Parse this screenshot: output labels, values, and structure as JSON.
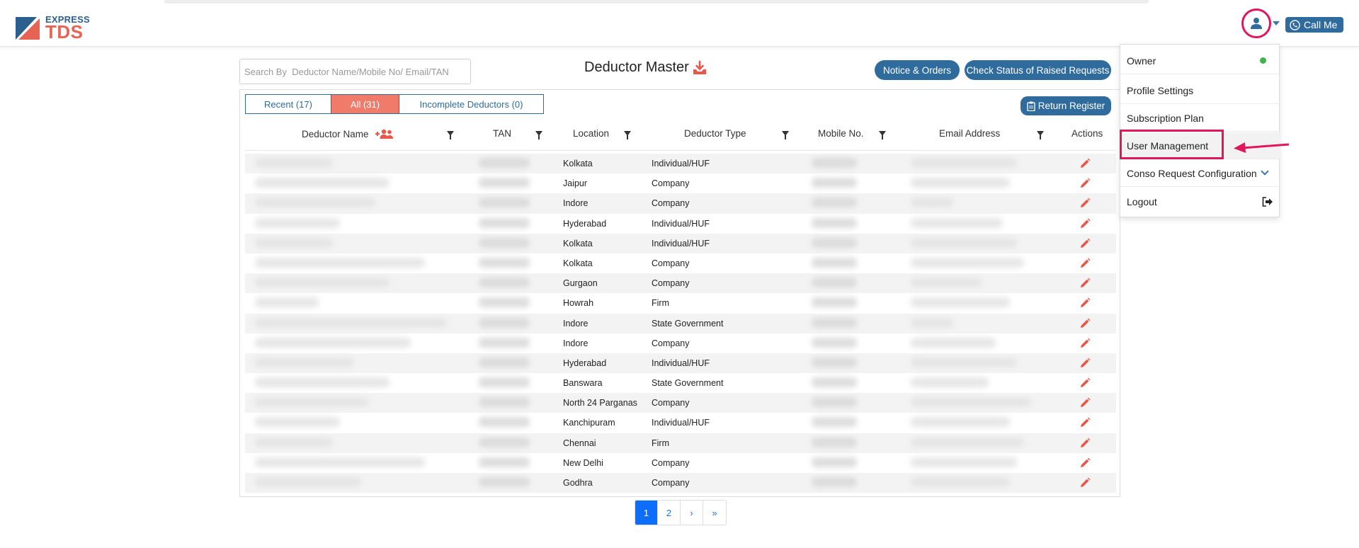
{
  "logo": {
    "top_text": "EXPRESS",
    "main_text": "TDS"
  },
  "header": {
    "call_me_label": "Call Me"
  },
  "search": {
    "placeholder": "Search By  Deductor Name/Mobile No/ Email/TAN"
  },
  "page": {
    "title": "Deductor Master"
  },
  "buttons": {
    "notice_orders": "Notice & Orders",
    "check_status": "Check Status of Raised Requests",
    "return_register": "Return Register"
  },
  "tabs": [
    {
      "label": "Recent (17)"
    },
    {
      "label": "All (31)",
      "active": true
    },
    {
      "label": "Incomplete Deductors (0)"
    }
  ],
  "columns": {
    "deductor_name": "Deductor Name",
    "tan": "TAN",
    "location": "Location",
    "deductor_type": "Deductor Type",
    "mobile": "Mobile No.",
    "email": "Email Address",
    "actions": "Actions"
  },
  "rows": [
    {
      "location": "Kolkata",
      "type": "Individual/HUF"
    },
    {
      "location": "Jaipur",
      "type": "Company"
    },
    {
      "location": "Indore",
      "type": "Company"
    },
    {
      "location": "Hyderabad",
      "type": "Individual/HUF"
    },
    {
      "location": "Kolkata",
      "type": "Individual/HUF"
    },
    {
      "location": "Kolkata",
      "type": "Company"
    },
    {
      "location": "Gurgaon",
      "type": "Company"
    },
    {
      "location": "Howrah",
      "type": "Firm"
    },
    {
      "location": "Indore",
      "type": "State Government"
    },
    {
      "location": "Indore",
      "type": "Company"
    },
    {
      "location": "Hyderabad",
      "type": "Individual/HUF"
    },
    {
      "location": "Banswara",
      "type": "State Government"
    },
    {
      "location": "North 24 Parganas",
      "type": "Company"
    },
    {
      "location": "Kanchipuram",
      "type": "Individual/HUF"
    },
    {
      "location": "Chennai",
      "type": "Firm"
    },
    {
      "location": "New Delhi",
      "type": "Company"
    },
    {
      "location": "Godhra",
      "type": "Company"
    }
  ],
  "pagination": {
    "pages": [
      "1",
      "2"
    ],
    "next": "›",
    "last": "»",
    "current": "1"
  },
  "dropdown": {
    "items": [
      {
        "label": "Owner"
      },
      {
        "label": "Profile Settings"
      },
      {
        "label": "Subscription Plan"
      },
      {
        "label": "User Management"
      },
      {
        "label": "Conso Request Configuration"
      },
      {
        "label": "Logout"
      }
    ]
  },
  "colors": {
    "accent": "#2f6b9d",
    "active_tab": "#f07b6b",
    "highlight": "#e3155b",
    "pencil": "#e8574a"
  }
}
